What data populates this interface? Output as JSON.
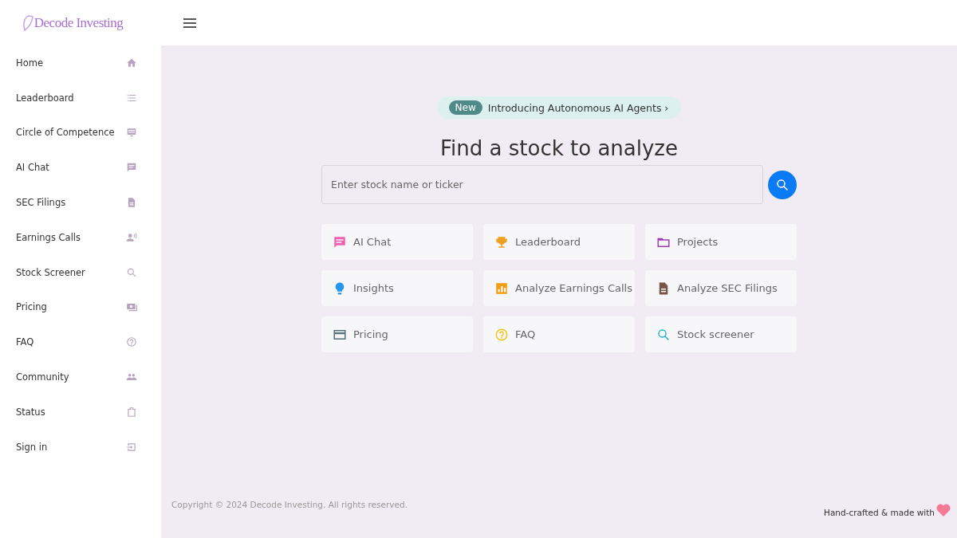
{
  "brand": "Decode Investing",
  "sidebar": {
    "items": [
      {
        "label": "Home"
      },
      {
        "label": "Leaderboard"
      },
      {
        "label": "Circle of Competence"
      },
      {
        "label": "AI Chat"
      },
      {
        "label": "SEC Filings"
      },
      {
        "label": "Earnings Calls"
      },
      {
        "label": "Stock Screener"
      },
      {
        "label": "Pricing"
      },
      {
        "label": "FAQ"
      },
      {
        "label": "Community"
      },
      {
        "label": "Status"
      },
      {
        "label": "Sign in"
      }
    ]
  },
  "announcement": {
    "badge": "New",
    "text": "Introducing Autonomous AI Agents ›"
  },
  "heading": "Find a stock to analyze",
  "search": {
    "placeholder": "Enter stock name or ticker"
  },
  "shortcuts": [
    {
      "label": "AI Chat"
    },
    {
      "label": "Leaderboard"
    },
    {
      "label": "Projects"
    },
    {
      "label": "Insights"
    },
    {
      "label": "Analyze Earnings Calls"
    },
    {
      "label": "Analyze SEC Filings"
    },
    {
      "label": "Pricing"
    },
    {
      "label": "FAQ"
    },
    {
      "label": "Stock screener"
    }
  ],
  "footer": {
    "copyright": "Copyright © 2024 Decode Investing. All rights reserved.",
    "credit": "Hand-crafted & made with"
  }
}
